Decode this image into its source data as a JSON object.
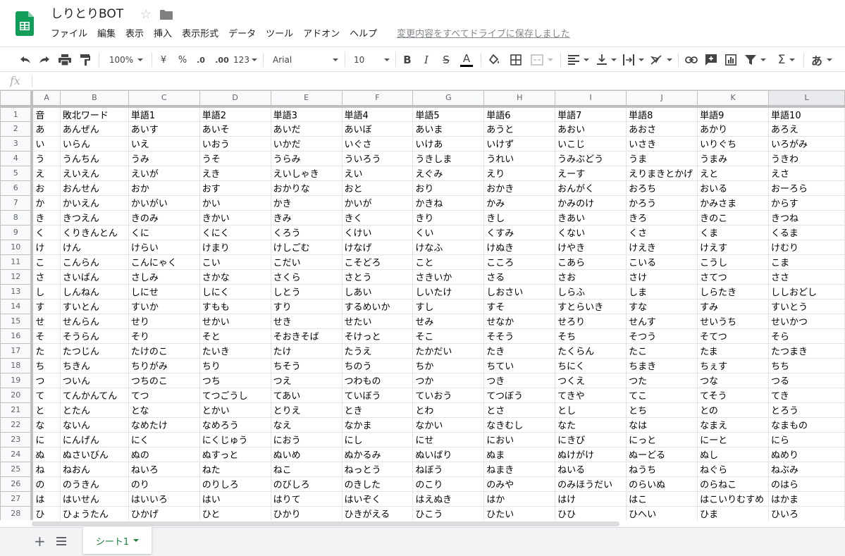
{
  "header": {
    "title": "しりとりBOT",
    "menu": [
      "ファイル",
      "編集",
      "表示",
      "挿入",
      "表示形式",
      "データ",
      "ツール",
      "アドオン",
      "ヘルプ"
    ],
    "save_status": "変更内容をすべてドライブに保存しました"
  },
  "toolbar": {
    "zoom": "100%",
    "currency": "¥",
    "percent": "%",
    "dec_decrease": ".0",
    "dec_increase": ".00",
    "more_formats": "123",
    "font": "Arial",
    "font_size": "10",
    "bold": "B",
    "italic": "I",
    "strike": "S",
    "text_color": "A",
    "input_tools": "あ"
  },
  "formula_bar": {
    "fx": "fx",
    "value": ""
  },
  "columns": [
    "A",
    "B",
    "C",
    "D",
    "E",
    "F",
    "G",
    "H",
    "I",
    "J",
    "K",
    "L"
  ],
  "rows": [
    [
      "音",
      "敗北ワード",
      "単語1",
      "単語2",
      "単語3",
      "単語4",
      "単語5",
      "単語6",
      "単語7",
      "単語8",
      "単語9",
      "単語10"
    ],
    [
      "あ",
      "あんぜん",
      "あいす",
      "あいそ",
      "あいだ",
      "あいぼ",
      "あいま",
      "あうと",
      "あおい",
      "あおさ",
      "あかり",
      "あろえ"
    ],
    [
      "い",
      "いらん",
      "いえ",
      "いおう",
      "いかだ",
      "いぐさ",
      "いけあ",
      "いけず",
      "いこじ",
      "いさき",
      "いりぐち",
      "いろがみ"
    ],
    [
      "う",
      "うんちん",
      "うみ",
      "うそ",
      "うらみ",
      "ういろう",
      "うきしま",
      "うれい",
      "うみぶどう",
      "うま",
      "うまみ",
      "うきわ"
    ],
    [
      "え",
      "えいえん",
      "えいが",
      "えき",
      "えいしゃき",
      "えい",
      "えぐみ",
      "えり",
      "えーす",
      "えりまきとかげ",
      "えと",
      "えさ"
    ],
    [
      "お",
      "おんせん",
      "おか",
      "おす",
      "おかりな",
      "おと",
      "おり",
      "おかき",
      "おんがく",
      "おろち",
      "おいる",
      "おーろら"
    ],
    [
      "か",
      "かいえん",
      "かいがい",
      "かい",
      "かき",
      "かいが",
      "かきね",
      "かみ",
      "かみのけ",
      "かろう",
      "かみさま",
      "からす"
    ],
    [
      "き",
      "きつえん",
      "きのみ",
      "きかい",
      "きみ",
      "きく",
      "きり",
      "きし",
      "きあい",
      "きろ",
      "きのこ",
      "きつね"
    ],
    [
      "く",
      "くりきんとん",
      "くに",
      "くにく",
      "くろう",
      "くけい",
      "くい",
      "くすみ",
      "くない",
      "くさ",
      "くま",
      "くるま"
    ],
    [
      "け",
      "けん",
      "けらい",
      "けまり",
      "けしごむ",
      "けなげ",
      "けなふ",
      "けぬき",
      "けやき",
      "けえき",
      "けえす",
      "けむり"
    ],
    [
      "こ",
      "こんらん",
      "こんにゃく",
      "こい",
      "こだい",
      "こそどろ",
      "こと",
      "こころ",
      "こあら",
      "こいる",
      "こうし",
      "こま"
    ],
    [
      "さ",
      "さいばん",
      "さしみ",
      "さかな",
      "さくら",
      "さとう",
      "さきいか",
      "さる",
      "さお",
      "さけ",
      "さてつ",
      "ささ"
    ],
    [
      "し",
      "しんねん",
      "しにせ",
      "しにく",
      "しとう",
      "しあい",
      "しいたけ",
      "しおさい",
      "しらふ",
      "しま",
      "しらたき",
      "ししおどし"
    ],
    [
      "す",
      "すいとん",
      "すいか",
      "すもも",
      "すり",
      "するめいか",
      "すし",
      "すそ",
      "すとらいき",
      "すな",
      "すみ",
      "すいとう"
    ],
    [
      "せ",
      "せんらん",
      "せり",
      "せかい",
      "せき",
      "せたい",
      "せみ",
      "せなか",
      "せろり",
      "せんす",
      "せいうち",
      "せいかつ"
    ],
    [
      "そ",
      "そうらん",
      "そり",
      "そと",
      "そおきそば",
      "そけっと",
      "そこ",
      "そそう",
      "そち",
      "そつう",
      "そてつ",
      "そら"
    ],
    [
      "た",
      "たつじん",
      "たけのこ",
      "たいき",
      "たけ",
      "たうえ",
      "たかだい",
      "たき",
      "たくらん",
      "たこ",
      "たま",
      "たつまき"
    ],
    [
      "ち",
      "ちきん",
      "ちりがみ",
      "ちり",
      "ちそう",
      "ちのう",
      "ちか",
      "ちてい",
      "ちにく",
      "ちまき",
      "ちぇす",
      "ちち"
    ],
    [
      "つ",
      "ついん",
      "つちのこ",
      "つち",
      "つえ",
      "つわもの",
      "つか",
      "つき",
      "つくえ",
      "つた",
      "つな",
      "つる"
    ],
    [
      "て",
      "てんかんてん",
      "てつ",
      "てつごうし",
      "てあい",
      "ていぼう",
      "ていおう",
      "てつぼう",
      "てきや",
      "てこ",
      "てそう",
      "てき"
    ],
    [
      "と",
      "とたん",
      "とな",
      "とかい",
      "とりえ",
      "とき",
      "とわ",
      "とさ",
      "とし",
      "とち",
      "との",
      "とろう"
    ],
    [
      "な",
      "ないん",
      "なめたけ",
      "なめろう",
      "なえ",
      "なかま",
      "なかい",
      "なきむし",
      "なた",
      "なは",
      "なまえ",
      "なまもの"
    ],
    [
      "に",
      "にんげん",
      "にく",
      "にくじゅう",
      "におう",
      "にし",
      "にせ",
      "におい",
      "にきび",
      "にっと",
      "にーと",
      "にら"
    ],
    [
      "ぬ",
      "ぬさいびん",
      "ぬの",
      "ぬすっと",
      "ぬいめ",
      "ぬかるみ",
      "ぬいばり",
      "ぬま",
      "ぬけがけ",
      "ぬーどる",
      "ぬし",
      "ぬめり"
    ],
    [
      "ね",
      "ねおん",
      "ねいろ",
      "ねた",
      "ねこ",
      "ねっとう",
      "ねぼう",
      "ねまき",
      "ねいる",
      "ねうち",
      "ねぐら",
      "ねぶみ"
    ],
    [
      "の",
      "のうきん",
      "のり",
      "のりしろ",
      "のびしろ",
      "のきした",
      "のこり",
      "のみや",
      "のみほうだい",
      "のらいぬ",
      "のらねこ",
      "のはら"
    ],
    [
      "は",
      "はいせん",
      "はいいろ",
      "はい",
      "はりて",
      "はいぞく",
      "はえぬき",
      "はか",
      "はけ",
      "はこ",
      "はこいりむすめ",
      "はかま"
    ],
    [
      "ひ",
      "ひょうたん",
      "ひかげ",
      "ひと",
      "ひかり",
      "ひきがえる",
      "ひこう",
      "ひたい",
      "ひひ",
      "ひへい",
      "ひま",
      "ひいろ"
    ]
  ],
  "sheets": {
    "active": "シート1"
  },
  "colors": {
    "accent_green": "#188038",
    "sheets_logo": "#0f9d58"
  }
}
